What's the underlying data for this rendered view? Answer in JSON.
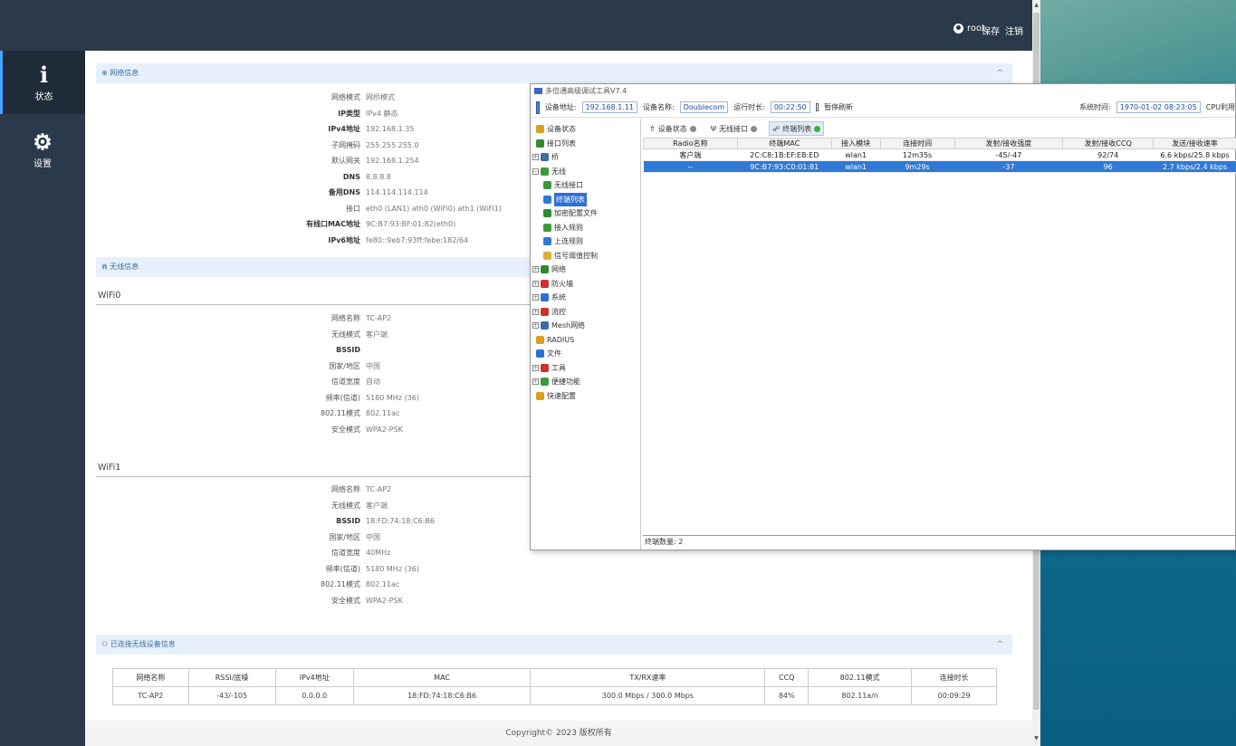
{
  "topbar": {
    "user": "root",
    "save": "保存",
    "logout": "注销"
  },
  "sidebar": {
    "items": [
      {
        "icon": "i",
        "label": "状态"
      },
      {
        "icon": "⚙",
        "label": "设置"
      }
    ]
  },
  "network": {
    "title": "网络信息",
    "rows": [
      {
        "key": "网络模式",
        "value": "网桥模式"
      },
      {
        "key": "IP类型",
        "value": "IPv4 静态"
      },
      {
        "key": "IPv4地址",
        "value": "192.168.1.35"
      },
      {
        "key": "子网掩码",
        "value": "255.255.255.0"
      },
      {
        "key": "默认网关",
        "value": "192.168.1.254"
      },
      {
        "key": "DNS",
        "value": "8.8.8.8"
      },
      {
        "key": "备用DNS",
        "value": "114.114.114.114"
      },
      {
        "key": "接口",
        "value": "eth0 (LAN1)   ath0 (WiFi0)   ath1 (WiFi1)"
      },
      {
        "key": "有线口MAC地址",
        "value": "9C:B7:93:BF:01:82(eth0)"
      },
      {
        "key": "IPv6地址",
        "value": "fe80::9eb7:93ff:febe:182/64"
      }
    ]
  },
  "wireless": {
    "title": "无线信息"
  },
  "wifi0": {
    "title": "WiFi0",
    "rows": [
      {
        "key": "网络名称",
        "value": "TC-AP2"
      },
      {
        "key": "无线模式",
        "value": "客户端"
      },
      {
        "key": "BSSID",
        "value": ""
      },
      {
        "key": "国家/地区",
        "value": "中国"
      },
      {
        "key": "信道宽度",
        "value": "自动"
      },
      {
        "key": "频率(信道)",
        "value": "5180 MHz (36)"
      },
      {
        "key": "802.11模式",
        "value": "802.11ac"
      },
      {
        "key": "安全模式",
        "value": "WPA2-PSK"
      }
    ]
  },
  "wifi1": {
    "title": "WiFi1",
    "rows": [
      {
        "key": "网络名称",
        "value": "TC-AP2"
      },
      {
        "key": "无线模式",
        "value": "客户端"
      },
      {
        "key": "BSSID",
        "value": "18:FD:74:18:C6:B6"
      },
      {
        "key": "国家/地区",
        "value": "中国"
      },
      {
        "key": "信道宽度",
        "value": "40MHz"
      },
      {
        "key": "频率(信道)",
        "value": "5180 MHz (36)"
      },
      {
        "key": "802.11模式",
        "value": "802.11ac"
      },
      {
        "key": "安全模式",
        "value": "WPA2-PSK"
      }
    ]
  },
  "connected": {
    "title": "已连接无线设备信息",
    "headers": [
      "网络名称",
      "RSSI/底噪",
      "IPv4地址",
      "MAC",
      "TX/RX速率",
      "CCQ",
      "802.11模式",
      "连接时长"
    ],
    "rows": [
      [
        "TC-AP2",
        "-43/-105",
        "0.0.0.0",
        "18:FD:74:18:C6:B6",
        "300.0 Mbps / 300.0 Mbps",
        "84%",
        "802.11a/n",
        "00:09:29"
      ]
    ]
  },
  "footer": "Copyright© 2023 版权所有",
  "tool": {
    "title": "多倍通高级调试工具V7.4",
    "addr_label": "设备地址:",
    "addr": "192.168.1.11",
    "name_label": "设备名称:",
    "name": "Doublecom",
    "uptime_label": "运行时长:",
    "uptime": "00:22:50",
    "pause": "暂停刷新",
    "systime_label": "系统时间:",
    "systime": "1970-01-02 08:23:05",
    "cpu": "CPU利用",
    "tree": [
      "设备状态",
      "接口列表",
      "桥",
      "无线",
      "无线接口",
      "终端列表",
      "加密配置文件",
      "接入规则",
      "上连规则",
      "信号阈值控制",
      "网络",
      "防火墙",
      "系统",
      "流控",
      "Mesh网络",
      "RADIUS",
      "文件",
      "工具",
      "便捷功能",
      "快速配置"
    ],
    "tabs": [
      "设备状态",
      "无线接口",
      "终端列表"
    ],
    "table_headers": [
      "Radio名称",
      "终端MAC",
      "接入模块",
      "连接时间",
      "发射/接收强度",
      "发射/接收CCQ",
      "发送/接收速率"
    ],
    "table_rows": [
      [
        "客户端",
        "2C:C8:1B:EF:EB:ED",
        "wlan1",
        "12m35s",
        "-45/-47",
        "92/74",
        "6.6 kbps/25.8 kbps"
      ],
      [
        "--",
        "9C:B7:93:C0:01:81",
        "wlan1",
        "9m29s",
        "-37",
        "96",
        "2.7 kbps/2.4 kbps"
      ]
    ],
    "status": "终端数量: 2"
  },
  "colors": {
    "sidebar": "#2b3a4a",
    "accent": "#2f7ad6",
    "section_bg": "#e8f1fb"
  }
}
